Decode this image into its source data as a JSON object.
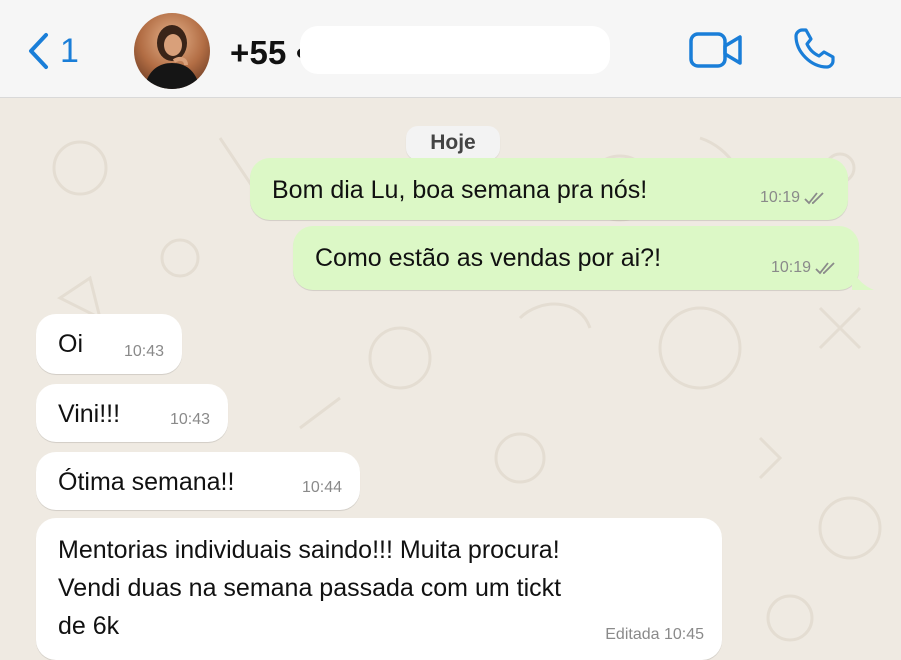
{
  "header": {
    "back_count": "1",
    "contact_name": "+55 •",
    "icons": {
      "back": "chevron-left-icon",
      "video": "video-camera-icon",
      "phone": "phone-icon"
    },
    "accent_color": "#1a7ed8"
  },
  "chat": {
    "date_label": "Hoje",
    "messages": [
      {
        "direction": "out",
        "text": "Bom dia Lu, boa semana pra nós!",
        "time": "10:19",
        "status": "read"
      },
      {
        "direction": "out",
        "text": "Como estão as vendas por ai?!",
        "time": "10:19",
        "status": "read"
      },
      {
        "direction": "in",
        "text": "Oi",
        "time": "10:43"
      },
      {
        "direction": "in",
        "text": "Vini!!!",
        "time": "10:43"
      },
      {
        "direction": "in",
        "text": "Ótima semana!!",
        "time": "10:44"
      },
      {
        "direction": "in",
        "lines": [
          "Mentorias individuais saindo!!! Muita procura!",
          "Vendi duas na semana passada com um tickt",
          "de 6k"
        ],
        "time": "Editada 10:45"
      }
    ],
    "colors": {
      "outgoing_bubble": "#dcf8c6",
      "incoming_bubble": "#ffffff",
      "wallpaper": "#efeae2"
    }
  }
}
